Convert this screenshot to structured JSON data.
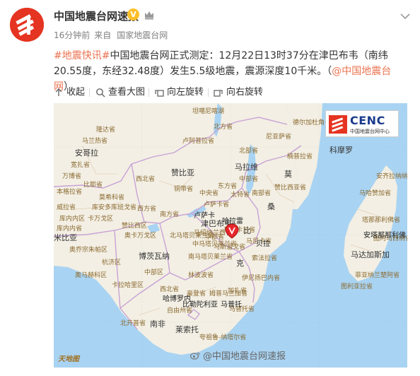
{
  "post": {
    "author": "中国地震台网速报",
    "time": "16分钟前",
    "source_prefix": "来自",
    "source": "国家地震台网",
    "hashtag": "#地震快讯#",
    "text": "中国地震台网正式测定：12月22日13时37分在津巴布韦（南纬20.55度，东经32.48度）发生5.5级地震，震源深度10千米。（",
    "link": "@中国地震台网",
    "text_end": "）"
  },
  "toolbar": {
    "collapse": "收起",
    "view_large": "查看大图",
    "rotate_left": "向左旋转",
    "rotate_right": "向右旋转"
  },
  "map": {
    "cenc": "CENC",
    "cenc_sub": "中国地震台网中心",
    "watermark": "@中国地震台网速报",
    "corner": "天地图",
    "countries": {
      "angola": "安哥拉",
      "zambia": "赞比亚",
      "malawi": "马拉维",
      "mozambique_1": "莫",
      "mozambique_2": "桑",
      "mozambique_3": "比",
      "mozambique_4": "克",
      "zimbabwe": "津巴布韦",
      "namibia": "米比亚",
      "botswana": "博茨瓦纳",
      "south_africa": "南非",
      "lesotho": "莱索托",
      "madagascar": "马达加斯加",
      "comoros": "科摩罗"
    },
    "labels": [
      "坦噶尼喀湖",
      "北方省",
      "卢阿普拉省",
      "铜带省",
      "西北省",
      "中央省",
      "东方省",
      "卢萨卡省",
      "南方省",
      "西方省",
      "北部省",
      "中部省",
      "南部省",
      "尼亚萨省",
      "德尔加杜角省",
      "楠普拉省",
      "赞比西亚省",
      "太特省",
      "马尼卡省",
      "索法拉省",
      "伊尼扬巴内省",
      "加扎省",
      "马普托省",
      "马绍纳兰西省",
      "马尼卡兰省",
      "马斯温戈省",
      "中马塔贝莱兰省",
      "北马塔贝莱兰省",
      "南马塔贝莱兰省",
      "中部省",
      "林波波省",
      "姆普马兰加省",
      "豪登省",
      "西北省",
      "自由州省",
      "夸祖鲁-纳塔尔省",
      "北开普省",
      "奥卡万戈区",
      "杭济区",
      "卡拉哈里区",
      "中部区",
      "库内内区",
      "卡万戈区",
      "赞比西区",
      "奥乔宗朱帕区",
      "奥马赫科区",
      "马哈赞加省",
      "塔那那利佛省",
      "菲亚纳兰楚阿省",
      "图利亚拉省",
      "安齐拉纳纳省",
      "图阿马西纳省",
      "莫希科省",
      "库安多库班戈省",
      "威拉省",
      "库内内省",
      "比耶省",
      "万博省",
      "本格拉省",
      "宽扎省",
      "隆达省",
      "马兰热省"
    ],
    "cities": [
      "卢萨卡",
      "哈拉雷",
      "贝拉",
      "哈博罗内",
      "比勒陀利亚",
      "马普托",
      "安塔那那利佛"
    ]
  },
  "colors": {
    "accent": "#eb7350",
    "land": "#f3efe4",
    "water": "#a9d3f2",
    "border": "#c8a2d6",
    "quake": "#e8262a"
  }
}
